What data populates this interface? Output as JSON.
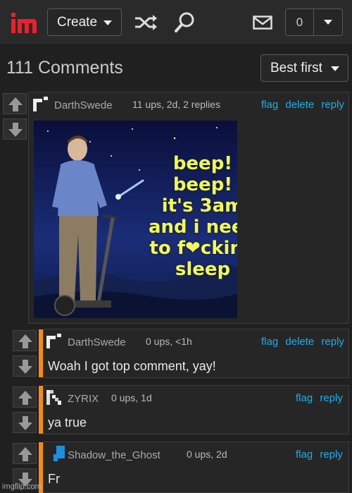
{
  "topbar": {
    "create_label": "Create",
    "notification_count": "0"
  },
  "comments_header": {
    "title": "111 Comments",
    "sort_label": "Best first"
  },
  "comments": [
    {
      "username": "DarthSwede",
      "meta": "11 ups, 2d, 2 replies",
      "actions": [
        "flag",
        "delete",
        "reply"
      ],
      "meme_text": [
        "beep!",
        "beep!",
        "it's 3am",
        "and i need",
        "to f❤cking",
        "sleep"
      ]
    },
    {
      "username": "DarthSwede",
      "meta": "0 ups, <1h",
      "actions": [
        "flag",
        "delete",
        "reply"
      ],
      "text": "Woah I got top comment, yay!"
    },
    {
      "username": "ZYRIX",
      "meta": "0 ups, 1d",
      "actions": [
        "flag",
        "reply"
      ],
      "text": "ya true"
    },
    {
      "username": "Shadow_the_Ghost",
      "meta": "0 ups, 2d",
      "actions": [
        "flag",
        "reply"
      ],
      "text": "Fr"
    }
  ],
  "watermark": "imgflip.com",
  "colors": {
    "accent": "#1eaee8",
    "reply_bar": "#f58a1f",
    "logo_red": "#e8212e",
    "meme_text": "#f0f85a"
  }
}
